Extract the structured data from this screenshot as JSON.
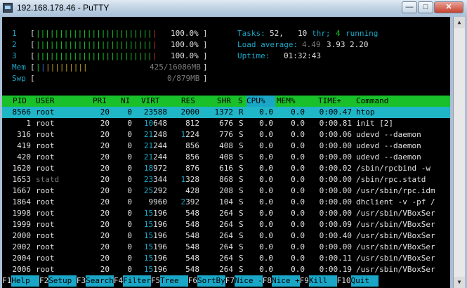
{
  "window": {
    "title": "192.168.178.46 - PuTTY",
    "min": "—",
    "max": "□",
    "close": "✕"
  },
  "meters": {
    "cpu": [
      {
        "id": "1",
        "bar": "||||||||||||||||||||||||||",
        "pct": "100.0%"
      },
      {
        "id": "2",
        "bar": "||||||||||||||||||||||||||",
        "pct": "100.0%"
      },
      {
        "id": "3",
        "bar": "||||||||||||||||||||||||||",
        "pct": "100.0%"
      }
    ],
    "mem": {
      "label": "Mem",
      "bar_blue": "|",
      "bar_yellow": "|||||||||",
      "value": "425/16086MB"
    },
    "swp": {
      "label": "Swp",
      "value": "0/879MB"
    }
  },
  "stats": {
    "tasks_label": "Tasks:",
    "tasks": "52,",
    "thr": "10",
    "thr_label": "thr;",
    "running": "4",
    "running_label": "running",
    "load_label": "Load average:",
    "load1": "4.49",
    "load5": "3.93",
    "load15": "2.20",
    "uptime_label": "Uptime:",
    "uptime": "01:32:43"
  },
  "columns": [
    "PID",
    "USER",
    "PRI",
    "NI",
    "VIRT",
    "RES",
    "SHR",
    "S",
    "CPU%",
    "MEM%",
    "TIME+",
    "Command"
  ],
  "sort_column": "CPU%",
  "processes": [
    {
      "pid": "8566",
      "user": "root",
      "pri": "20",
      "ni": "0",
      "virt_a": "23",
      "virt_b": "588",
      "res_a": "",
      "res_b": "2000",
      "shr": "1372",
      "s": "R",
      "cpu": "0.0",
      "mem": "0.0",
      "time": "0:00.47",
      "cmd": "htop",
      "selected": true
    },
    {
      "pid": "1",
      "user": "root",
      "pri": "20",
      "ni": "0",
      "virt_a": "10",
      "virt_b": "648",
      "res_a": "",
      "res_b": "812",
      "shr": "676",
      "s": "S",
      "cpu": "0.0",
      "mem": "0.0",
      "time": "0:00.81",
      "cmd": "init [2]"
    },
    {
      "pid": "316",
      "user": "root",
      "pri": "20",
      "ni": "0",
      "virt_a": "21",
      "virt_b": "248",
      "res_a": "1",
      "res_b": "224",
      "shr": "776",
      "s": "S",
      "cpu": "0.0",
      "mem": "0.0",
      "time": "0:00.06",
      "cmd": "udevd --daemon"
    },
    {
      "pid": "419",
      "user": "root",
      "pri": "20",
      "ni": "0",
      "virt_a": "21",
      "virt_b": "244",
      "res_a": "",
      "res_b": "856",
      "shr": "408",
      "s": "S",
      "cpu": "0.0",
      "mem": "0.0",
      "time": "0:00.00",
      "cmd": "udevd --daemon"
    },
    {
      "pid": "420",
      "user": "root",
      "pri": "20",
      "ni": "0",
      "virt_a": "21",
      "virt_b": "244",
      "res_a": "",
      "res_b": "856",
      "shr": "408",
      "s": "S",
      "cpu": "0.0",
      "mem": "0.0",
      "time": "0:00.00",
      "cmd": "udevd --daemon"
    },
    {
      "pid": "1620",
      "user": "root",
      "pri": "20",
      "ni": "0",
      "virt_a": "18",
      "virt_b": "972",
      "res_a": "",
      "res_b": "876",
      "shr": "616",
      "s": "S",
      "cpu": "0.0",
      "mem": "0.0",
      "time": "0:00.02",
      "cmd": "/sbin/rpcbind -w"
    },
    {
      "pid": "1653",
      "user": "statd",
      "pri": "20",
      "ni": "0",
      "virt_a": "23",
      "virt_b": "344",
      "res_a": "1",
      "res_b": "328",
      "shr": "868",
      "s": "S",
      "cpu": "0.0",
      "mem": "0.0",
      "time": "0:00.00",
      "cmd": "/sbin/rpc.statd",
      "dim_user": true
    },
    {
      "pid": "1667",
      "user": "root",
      "pri": "20",
      "ni": "0",
      "virt_a": "25",
      "virt_b": "292",
      "res_a": "",
      "res_b": "428",
      "shr": "208",
      "s": "S",
      "cpu": "0.0",
      "mem": "0.0",
      "time": "0:00.00",
      "cmd": "/usr/sbin/rpc.idm"
    },
    {
      "pid": "1864",
      "user": "root",
      "pri": "20",
      "ni": "0",
      "virt_a": "",
      "virt_b": "9960",
      "res_a": "2",
      "res_b": "392",
      "shr": "104",
      "s": "S",
      "cpu": "0.0",
      "mem": "0.0",
      "time": "0:00.00",
      "cmd": "dhclient -v -pf /"
    },
    {
      "pid": "1998",
      "user": "root",
      "pri": "20",
      "ni": "0",
      "virt_a": "15",
      "virt_b": "196",
      "res_a": "",
      "res_b": "548",
      "shr": "264",
      "s": "S",
      "cpu": "0.0",
      "mem": "0.0",
      "time": "0:00.00",
      "cmd": "/usr/sbin/VBoxSer"
    },
    {
      "pid": "1999",
      "user": "root",
      "pri": "20",
      "ni": "0",
      "virt_a": "15",
      "virt_b": "196",
      "res_a": "",
      "res_b": "548",
      "shr": "264",
      "s": "S",
      "cpu": "0.0",
      "mem": "0.0",
      "time": "0:00.09",
      "cmd": "/usr/sbin/VBoxSer"
    },
    {
      "pid": "2000",
      "user": "root",
      "pri": "20",
      "ni": "0",
      "virt_a": "15",
      "virt_b": "196",
      "res_a": "",
      "res_b": "548",
      "shr": "264",
      "s": "S",
      "cpu": "0.0",
      "mem": "0.0",
      "time": "0:00.40",
      "cmd": "/usr/sbin/VBoxSer"
    },
    {
      "pid": "2002",
      "user": "root",
      "pri": "20",
      "ni": "0",
      "virt_a": "15",
      "virt_b": "196",
      "res_a": "",
      "res_b": "548",
      "shr": "264",
      "s": "S",
      "cpu": "0.0",
      "mem": "0.0",
      "time": "0:00.00",
      "cmd": "/usr/sbin/VBoxSer"
    },
    {
      "pid": "2004",
      "user": "root",
      "pri": "20",
      "ni": "0",
      "virt_a": "15",
      "virt_b": "196",
      "res_a": "",
      "res_b": "548",
      "shr": "264",
      "s": "S",
      "cpu": "0.0",
      "mem": "0.0",
      "time": "0:00.11",
      "cmd": "/usr/sbin/VBoxSer"
    },
    {
      "pid": "2006",
      "user": "root",
      "pri": "20",
      "ni": "0",
      "virt_a": "15",
      "virt_b": "196",
      "res_a": "",
      "res_b": "548",
      "shr": "264",
      "s": "S",
      "cpu": "0.0",
      "mem": "0.0",
      "time": "0:00.19",
      "cmd": "/usr/sbin/VBoxSer"
    }
  ],
  "function_keys": [
    {
      "key": "F1",
      "label": "Help  "
    },
    {
      "key": "F2",
      "label": "Setup "
    },
    {
      "key": "F3",
      "label": "Search"
    },
    {
      "key": "F4",
      "label": "Filter"
    },
    {
      "key": "F5",
      "label": "Tree  "
    },
    {
      "key": "F6",
      "label": "SortBy"
    },
    {
      "key": "F7",
      "label": "Nice -"
    },
    {
      "key": "F8",
      "label": "Nice +"
    },
    {
      "key": "F9",
      "label": "Kill  "
    },
    {
      "key": "F10",
      "label": "Quit  "
    }
  ],
  "colors": {
    "accent": "#1aa7c7",
    "header": "#19c02a",
    "bar_green": "#19c82b",
    "bar_red": "#cc2a2a"
  }
}
